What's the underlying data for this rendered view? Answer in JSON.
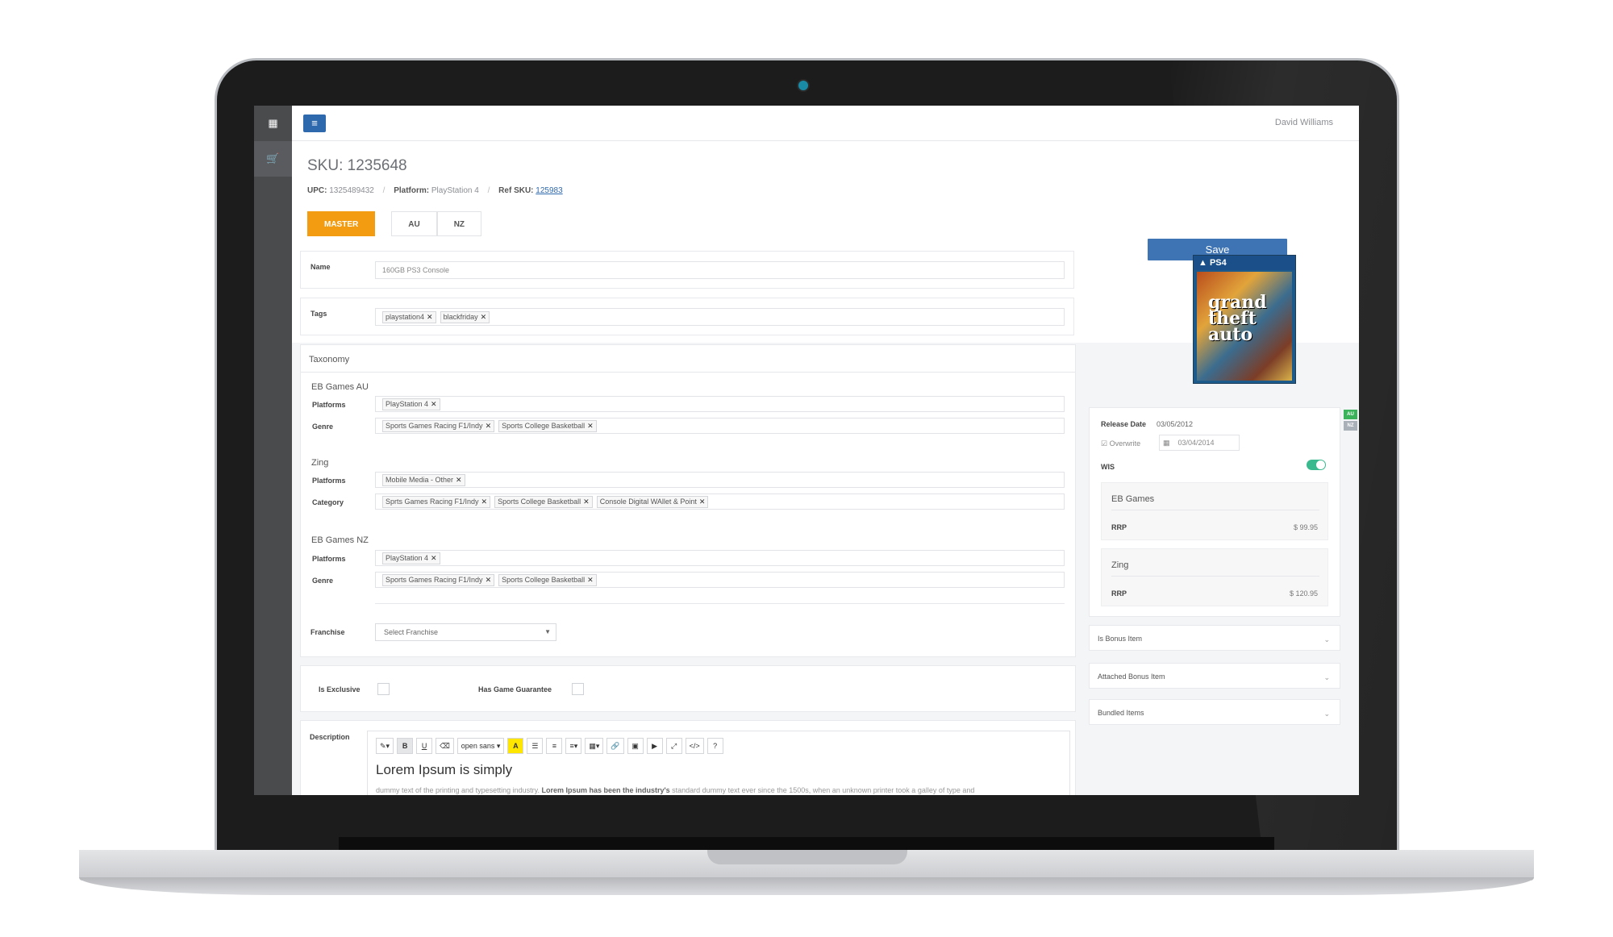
{
  "header": {
    "username": "David Williams",
    "sku_title": "SKU: 1235648"
  },
  "meta": {
    "upc_label": "UPC:",
    "upc": "1325489432",
    "platform_label": "Platform:",
    "platform": "PlayStation 4",
    "ref_label": "Ref SKU:",
    "ref": "125983"
  },
  "tabs": [
    "MASTER",
    "AU",
    "NZ"
  ],
  "save_label": "Save",
  "form": {
    "name_label": "Name",
    "name_value": "160GB PS3 Console",
    "tags_label": "Tags",
    "tags": [
      "playstation4",
      "blackfriday"
    ],
    "taxonomy_title": "Taxonomy",
    "groups": [
      {
        "title": "EB Games AU",
        "rows": [
          {
            "label": "Platforms",
            "tags": [
              "PlayStation 4"
            ]
          },
          {
            "label": "Genre",
            "tags": [
              "Sports Games Racing F1/Indy",
              "Sports College Basketball"
            ]
          }
        ]
      },
      {
        "title": "Zing",
        "rows": [
          {
            "label": "Platforms",
            "tags": [
              "Mobile Media - Other"
            ]
          },
          {
            "label": "Category",
            "tags": [
              "Sprts Games Racing F1/Indy",
              "Sports College Basketball",
              "Console Digital WAllet & Point"
            ]
          }
        ]
      },
      {
        "title": "EB Games NZ",
        "rows": [
          {
            "label": "Platforms",
            "tags": [
              "PlayStation 4"
            ]
          },
          {
            "label": "Genre",
            "tags": [
              "Sports Games Racing F1/Indy",
              "Sports College Basketball"
            ]
          }
        ]
      }
    ],
    "franchise_label": "Franchise",
    "franchise_placeholder": "Select Franchise",
    "exclusive_label": "Is Exclusive",
    "guarantee_label": "Has Game Guarantee",
    "description_label": "Description",
    "toolbar": [
      "wand",
      "B",
      "U",
      "eraser",
      "open sans",
      "A",
      "ul",
      "ol",
      "align",
      "table",
      "link",
      "image",
      "video",
      "fullscreen",
      "code",
      "?"
    ],
    "font_name": "open sans",
    "editor_heading": "Lorem Ipsum is simply",
    "editor_text": "dummy text of the printing and typesetting industry. ",
    "editor_text_bold": "Lorem Ipsum has been the industry's",
    "editor_text_rest": " standard dummy text ever since the 1500s, when an unknown printer took a galley of type and"
  },
  "right": {
    "cover_label": "PS4",
    "cover_title_lines": [
      "grand",
      "theft",
      "auto"
    ],
    "release_label": "Release Date",
    "release_date": "03/05/2012",
    "overwrite_label": "Overwrite",
    "overwrite_date": "03/04/2014",
    "wis_label": "WIS",
    "flags": [
      "AU",
      "NZ"
    ],
    "prices": [
      {
        "store": "EB Games",
        "rrp_label": "RRP",
        "price": "$ 99.95"
      },
      {
        "store": "Zing",
        "rrp_label": "RRP",
        "price": "$ 120.95"
      }
    ],
    "accordions": [
      "Is Bonus Item",
      "Attached Bonus Item",
      "Bundled Items"
    ]
  },
  "colors": {
    "accent": "#f39c12",
    "primary": "#3e74b3",
    "toggle": "#3bb98e",
    "sidebar": "#4a4b4d"
  }
}
